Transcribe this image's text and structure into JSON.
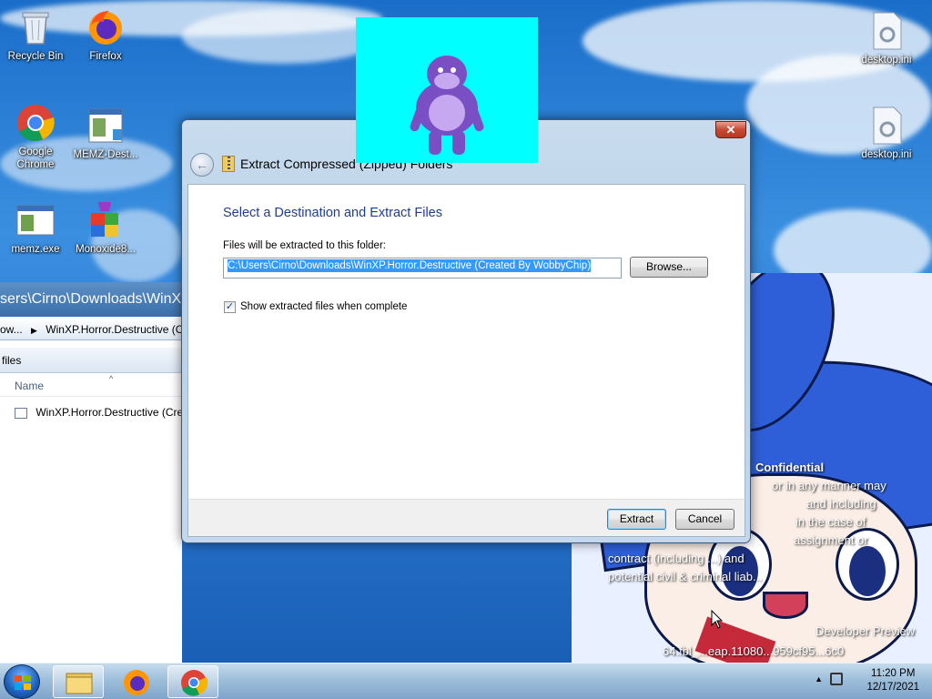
{
  "desktop": {
    "icons": [
      {
        "label": "Recycle Bin",
        "icon": "recycle-bin-icon"
      },
      {
        "label": "Firefox",
        "icon": "firefox-icon"
      },
      {
        "label": "Google Chrome",
        "icon": "chrome-icon"
      },
      {
        "label": "MEMZ-Dest...",
        "icon": "memz-shortcut-icon"
      },
      {
        "label": "memz.exe",
        "icon": "exe-icon"
      },
      {
        "label": "Monoxide8...",
        "icon": "monoxide-installer-icon"
      },
      {
        "label": "desktop.ini",
        "icon": "ini-file-icon"
      },
      {
        "label": "desktop.ini",
        "icon": "ini-file-icon"
      }
    ],
    "watermark": {
      "lines": [
        "Confidential",
        "or in any manner may",
        "and including",
        "in the case of",
        "assignment or",
        "contract (including ...) and",
        "potential civil & criminal liab..."
      ],
      "build_line1": "Developer Preview",
      "build_line2": "64.fbl_...eap.11080...959cf95...6c0"
    }
  },
  "explorer": {
    "address": "sers\\Cirno\\Downloads\\WinXP.H",
    "crumb_prefix": "ow...",
    "crumb_folder": "WinXP.Horror.Destructive  (C",
    "toolbar_item": "files",
    "column_name": "Name",
    "row_name": "WinXP.Horror.Destructive  (Cre"
  },
  "dialog": {
    "title": "Extract Compressed (Zipped) Folders",
    "heading": "Select a Destination and Extract Files",
    "files_label": "Files will be extracted to this folder:",
    "path_value": "C:\\Users\\Cirno\\Downloads\\WinXP.Horror.Destructive  (Created By WobbyChip)",
    "browse_label": "Browse...",
    "show_files_label": "Show extracted files when complete",
    "show_files_checked": true,
    "extract_label": "Extract",
    "cancel_label": "Cancel",
    "close_glyph": "✕"
  },
  "taskbar": {
    "apps": [
      "explorer",
      "firefox",
      "chrome"
    ],
    "time": "11:20 PM",
    "date": "12/17/2021"
  },
  "colors": {
    "heading_blue": "#1e3d8f",
    "selection": "#3399ff",
    "bonzi_bg": "#00ffff",
    "bonzi_purple": "#7b4fc4"
  }
}
